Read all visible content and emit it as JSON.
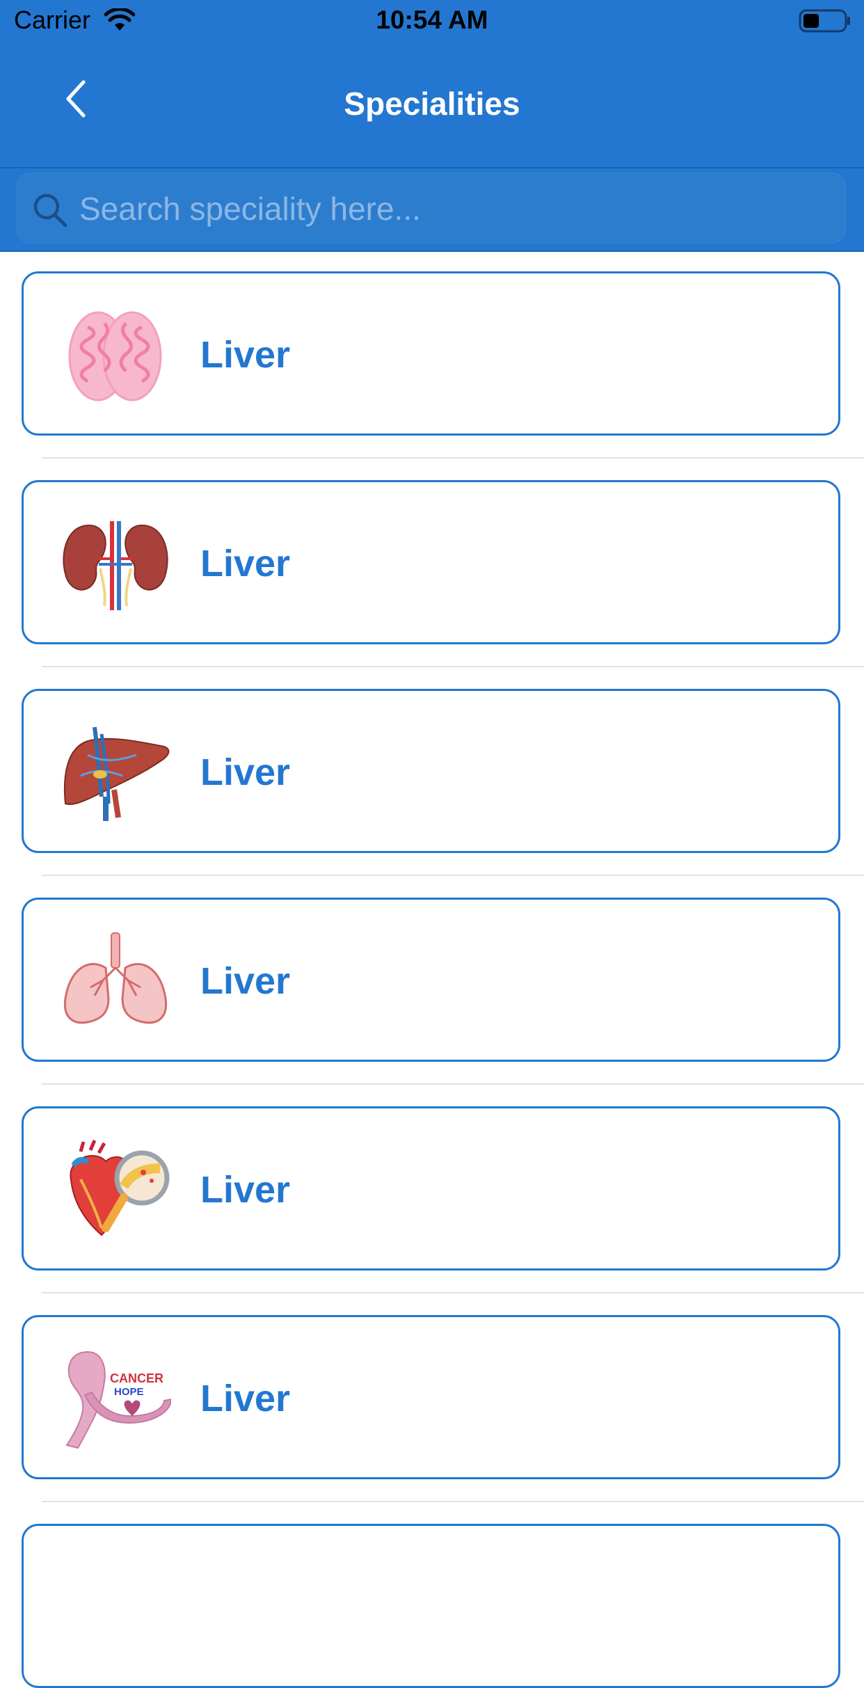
{
  "status_bar": {
    "carrier": "Carrier",
    "time": "10:54 AM"
  },
  "nav": {
    "title": "Specialities",
    "back_icon": "chevron-left-icon"
  },
  "search": {
    "placeholder": "Search speciality here...",
    "value": "",
    "icon": "search-icon"
  },
  "specialities": [
    {
      "label": "Liver",
      "icon": "brain-icon"
    },
    {
      "label": "Liver",
      "icon": "kidney-icon"
    },
    {
      "label": "Liver",
      "icon": "liver-icon"
    },
    {
      "label": "Liver",
      "icon": "lungs-icon"
    },
    {
      "label": "Liver",
      "icon": "heart-magnifier-icon"
    },
    {
      "label": "Liver",
      "icon": "cancer-ribbon-icon",
      "icon_text": [
        "CANCER",
        "HOPE"
      ]
    }
  ],
  "colors": {
    "primary": "#2377d0",
    "card_border": "#2377d0",
    "label": "#2377d0"
  }
}
